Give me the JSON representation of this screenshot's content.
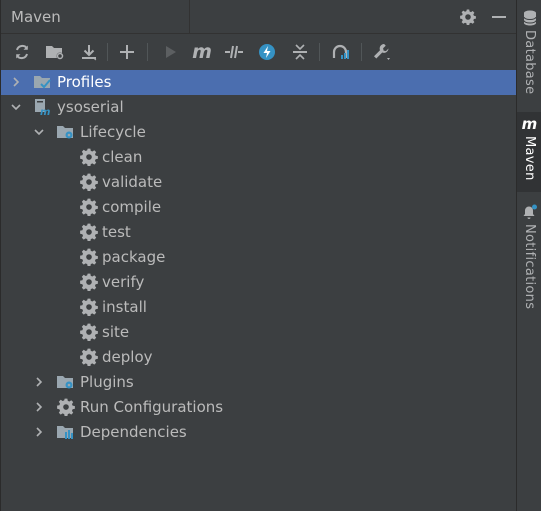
{
  "header": {
    "title": "Maven",
    "settings_icon": "gear-icon",
    "minimize_icon": "minimize-icon"
  },
  "toolbar": {
    "icons": [
      "reload-icon",
      "add-maven-project-icon",
      "download-icon",
      "plus-icon",
      "run-icon",
      "maven-goal-icon",
      "toggle-offline-icon",
      "skip-tests-icon",
      "collapse-all-icon",
      "analyze-dependencies-icon",
      "settings-wrench-icon"
    ]
  },
  "tree": {
    "profiles": "Profiles",
    "project": "ysoserial",
    "lifecycle": "Lifecycle",
    "goals": [
      "clean",
      "validate",
      "compile",
      "test",
      "package",
      "verify",
      "install",
      "site",
      "deploy"
    ],
    "plugins": "Plugins",
    "run_configurations": "Run Configurations",
    "dependencies": "Dependencies"
  },
  "right_bar": {
    "tabs": [
      "Database",
      "Maven",
      "Notifications"
    ],
    "active": "Maven"
  },
  "colors": {
    "background": "#3c3f41",
    "selection": "#4b6eaf",
    "text": "#bbbbbb",
    "accent_blue": "#3592c4"
  }
}
